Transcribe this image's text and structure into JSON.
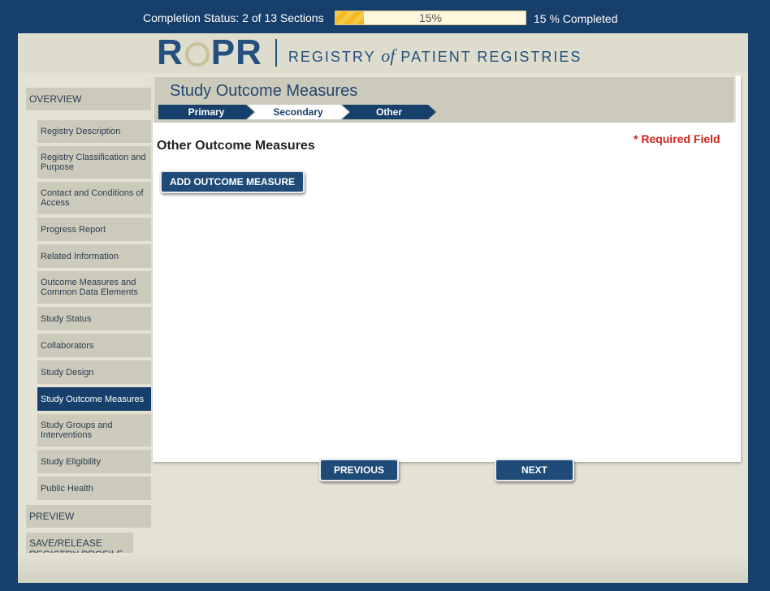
{
  "topbar": {
    "status_text": "Completion Status: 2 of 13 Sections",
    "progress_label": "15%",
    "progress_fraction": 0.15,
    "completed_text": "15 % Completed",
    "progress_color": "#f7c948"
  },
  "header": {
    "logo_text_r": "R",
    "logo_text_pr": "PR",
    "logo_sub_pre": "REGISTRY ",
    "logo_sub_of": "of",
    "logo_sub_post": " PATIENT REGISTRIES",
    "brand_color": "#24507f"
  },
  "sidebar": {
    "overview": "OVERVIEW",
    "items": [
      {
        "label": "Registry Description"
      },
      {
        "label": "Registry Classification and Purpose"
      },
      {
        "label": "Contact and Conditions of Access"
      },
      {
        "label": "Progress Report"
      },
      {
        "label": "Related Information"
      },
      {
        "label": "Outcome Measures and Common Data Elements"
      },
      {
        "label": "Study Status"
      },
      {
        "label": "Collaborators"
      },
      {
        "label": "Study Design"
      },
      {
        "label": "Study Outcome Measures"
      },
      {
        "label": "Study Groups and Interventions"
      },
      {
        "label": "Study Eligibility"
      },
      {
        "label": "Public Health"
      }
    ],
    "preview": "PREVIEW",
    "save_release": "SAVE/RELEASE REGISTRY PROFILE"
  },
  "main": {
    "title": "Study Outcome Measures",
    "tabs": [
      {
        "label": "Primary"
      },
      {
        "label": "Secondary"
      },
      {
        "label": "Other"
      }
    ],
    "section_title": "Other Outcome Measures",
    "required_note": "* Required Field",
    "add_button": "ADD OUTCOME MEASURE",
    "previous_button": "PREVIOUS",
    "next_button": "NEXT"
  }
}
